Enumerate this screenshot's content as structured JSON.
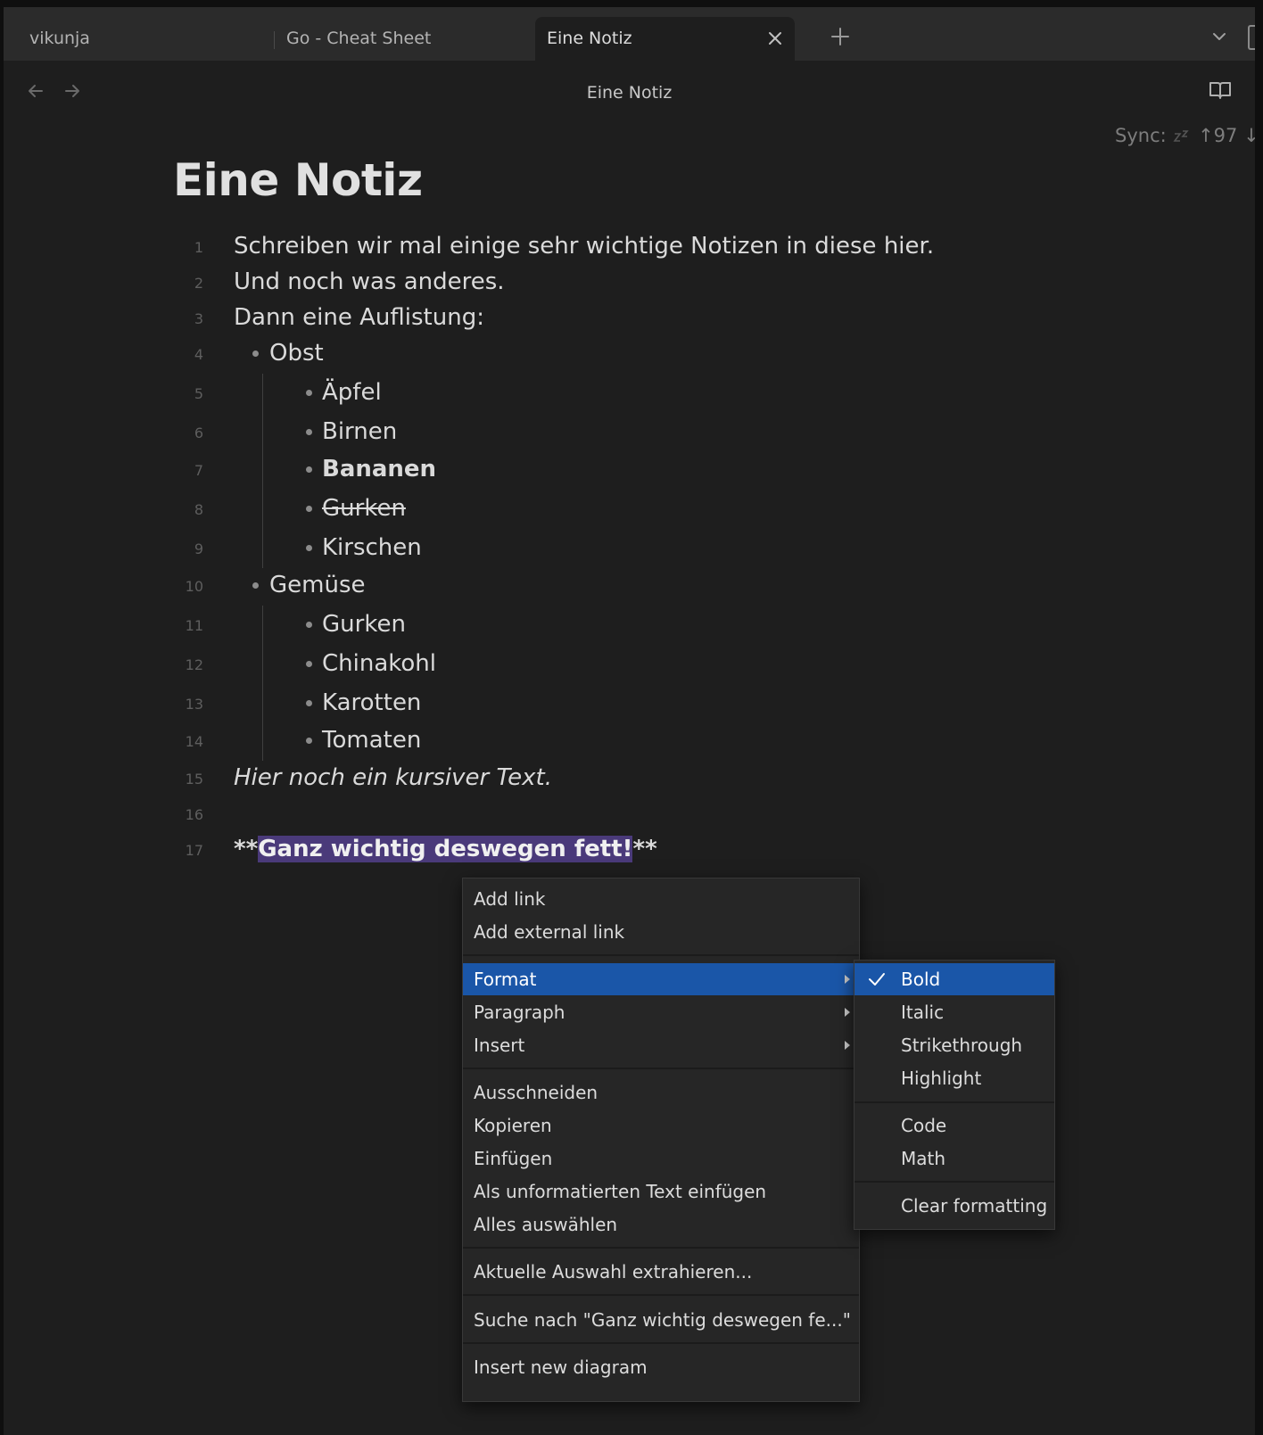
{
  "tabs": [
    {
      "label": "vikunja",
      "active": false
    },
    {
      "label": "Go - Cheat Sheet",
      "active": false
    },
    {
      "label": "Eine Notiz",
      "active": true
    }
  ],
  "view": {
    "title": "Eine Notiz"
  },
  "sync": {
    "label": "Sync:",
    "up": "↑97",
    "down": "↓"
  },
  "note": {
    "title": "Eine Notiz",
    "lines": [
      {
        "num": "1",
        "parts": [
          "Schreiben wir mal einige sehr wichtige Notizen in diese hier."
        ]
      },
      {
        "num": "2",
        "parts": [
          "Und noch was anderes."
        ]
      },
      {
        "num": "3",
        "parts": [
          "Dann eine Auflistung:"
        ]
      },
      {
        "num": "4",
        "parts": [
          "Obst"
        ]
      },
      {
        "num": "5",
        "parts": [
          "Äpfel"
        ]
      },
      {
        "num": "6",
        "parts": [
          "Birnen"
        ]
      },
      {
        "num": "7",
        "parts": [
          "Bananen"
        ]
      },
      {
        "num": "8",
        "parts": [
          "Gurken"
        ]
      },
      {
        "num": "9",
        "parts": [
          "Kirschen"
        ]
      },
      {
        "num": "10",
        "parts": [
          "Gemüse"
        ]
      },
      {
        "num": "11",
        "parts": [
          "Gurken"
        ]
      },
      {
        "num": "12",
        "parts": [
          "Chinakohl"
        ]
      },
      {
        "num": "13",
        "parts": [
          "Karotten"
        ]
      },
      {
        "num": "14",
        "parts": [
          "Tomaten"
        ]
      },
      {
        "num": "15",
        "parts": [
          "Hier noch ein kursiver Text."
        ]
      },
      {
        "num": "16",
        "parts": []
      },
      {
        "num": "17",
        "parts": [
          "**",
          "Ganz wichtig deswegen fett!",
          "**"
        ]
      }
    ]
  },
  "context_menu": {
    "add_link": "Add link",
    "add_external_link": "Add external link",
    "format": "Format",
    "paragraph": "Paragraph",
    "insert": "Insert",
    "cut": "Ausschneiden",
    "copy": "Kopieren",
    "paste": "Einfügen",
    "paste_plain": "Als unformatierten Text einfügen",
    "select_all": "Alles auswählen",
    "extract": "Aktuelle Auswahl extrahieren...",
    "search": "Suche nach \"Ganz wichtig deswegen fe...\"",
    "insert_diagram": "Insert new diagram"
  },
  "format_menu": {
    "bold": "Bold",
    "italic": "Italic",
    "strikethrough": "Strikethrough",
    "highlight": "Highlight",
    "code": "Code",
    "math": "Math",
    "clear": "Clear formatting"
  },
  "colors": {
    "accent": "#1a56a8",
    "selection": "#4a3a7a",
    "background": "#1e1e1e"
  }
}
